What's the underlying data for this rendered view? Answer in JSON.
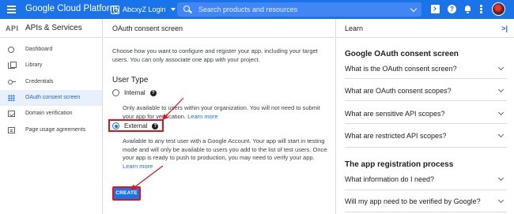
{
  "topbar": {
    "brand": "Google Cloud Platform",
    "project": "AbcxyZ Login",
    "search_placeholder": "Search products and resources",
    "help_glyph": "?"
  },
  "sidebar": {
    "logo": "API",
    "title": "APIs & Services",
    "items": [
      {
        "label": "Dashboard",
        "icon": "dashboard-icon"
      },
      {
        "label": "Library",
        "icon": "library-icon"
      },
      {
        "label": "Credentials",
        "icon": "key-icon"
      },
      {
        "label": "OAuth consent screen",
        "icon": "grid-icon",
        "active": true
      },
      {
        "label": "Domain verification",
        "icon": "checkbox-icon"
      },
      {
        "label": "Page usage agreements",
        "icon": "settings-icon"
      }
    ]
  },
  "main": {
    "title": "OAuth consent screen",
    "intro": "Choose how you want to configure and register your app, including your target users. You can only associate one app with your project.",
    "user_type_title": "User Type",
    "internal": {
      "label": "Internal",
      "desc": "Only available to users within your organization. You will not need to submit your app for verification.",
      "link": "Learn more"
    },
    "external": {
      "label": "External",
      "desc": "Available to any test user with a Google Account. Your app will start in testing mode and will only be available to users you add to the list of test users. Once your app is ready to push to production, you may need to verify your app.",
      "link": "Learn more"
    },
    "create_label": "CREATE",
    "help_glyph": "?"
  },
  "learn": {
    "title": "Learn",
    "collapse_glyph": ">|",
    "section1": "Google OAuth consent screen",
    "faqs1": [
      "What is the OAuth consent screen?",
      "What are OAuth consent scopes?",
      "What are sensitive API scopes?",
      "What are restricted API scopes?"
    ],
    "section2": "The app registration process",
    "faqs2": [
      "What information do I need?",
      "Will my app need to be verified by Google?"
    ]
  },
  "colors": {
    "accent": "#1a73e8",
    "highlight": "#e0151c"
  }
}
